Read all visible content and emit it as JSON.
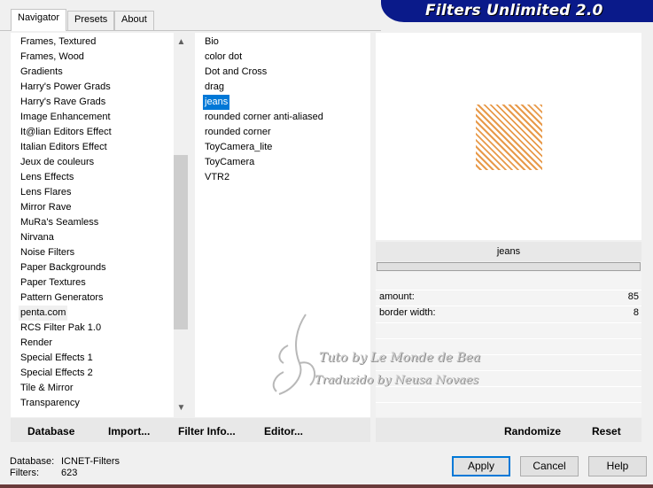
{
  "tabs": [
    {
      "label": "Navigator",
      "active": true
    },
    {
      "label": "Presets",
      "active": false
    },
    {
      "label": "About",
      "active": false
    }
  ],
  "banner": {
    "title": "Filters Unlimited 2.0"
  },
  "categories": [
    "Frames, Textured",
    "Frames, Wood",
    "Gradients",
    "Harry's Power Grads",
    "Harry's Rave Grads",
    "Image Enhancement",
    "It@lian Editors Effect",
    "Italian Editors Effect",
    "Jeux de couleurs",
    "Lens Effects",
    "Lens Flares",
    "Mirror Rave",
    "MuRa's Seamless",
    "Nirvana",
    "Noise Filters",
    "Paper Backgrounds",
    "Paper Textures",
    "Pattern Generators",
    "penta.com",
    "RCS Filter Pak 1.0",
    "Render",
    "Special Effects 1",
    "Special Effects 2",
    "Tile & Mirror",
    "Transparency"
  ],
  "selected_category": "penta.com",
  "filters": [
    "Bio",
    "color dot",
    "Dot and Cross",
    "drag",
    "jeans",
    "rounded corner anti-aliased",
    "rounded corner",
    "ToyCamera_lite",
    "ToyCamera",
    "VTR2"
  ],
  "selected_filter": "jeans",
  "preview": {
    "swatch_color": "#e89a4a"
  },
  "params": {
    "filter_name": "jeans",
    "rows": [
      {
        "label": "amount:",
        "value": "85"
      },
      {
        "label": "border width:",
        "value": "8"
      }
    ]
  },
  "toolbar": {
    "database_label": "Database",
    "import_label": "Import...",
    "filter_info_label": "Filter Info...",
    "editor_label": "Editor...",
    "randomize_label": "Randomize",
    "reset_label": "Reset"
  },
  "status": {
    "database_label": "Database:",
    "database_value": "ICNET-Filters",
    "filters_label": "Filters:",
    "filters_value": "623"
  },
  "dialog": {
    "apply_label": "Apply",
    "cancel_label": "Cancel",
    "help_label": "Help"
  },
  "watermark": {
    "line1": "Tuto by  Le Monde de Bea",
    "line2": "Traduzido by  Neusa Novaes"
  }
}
